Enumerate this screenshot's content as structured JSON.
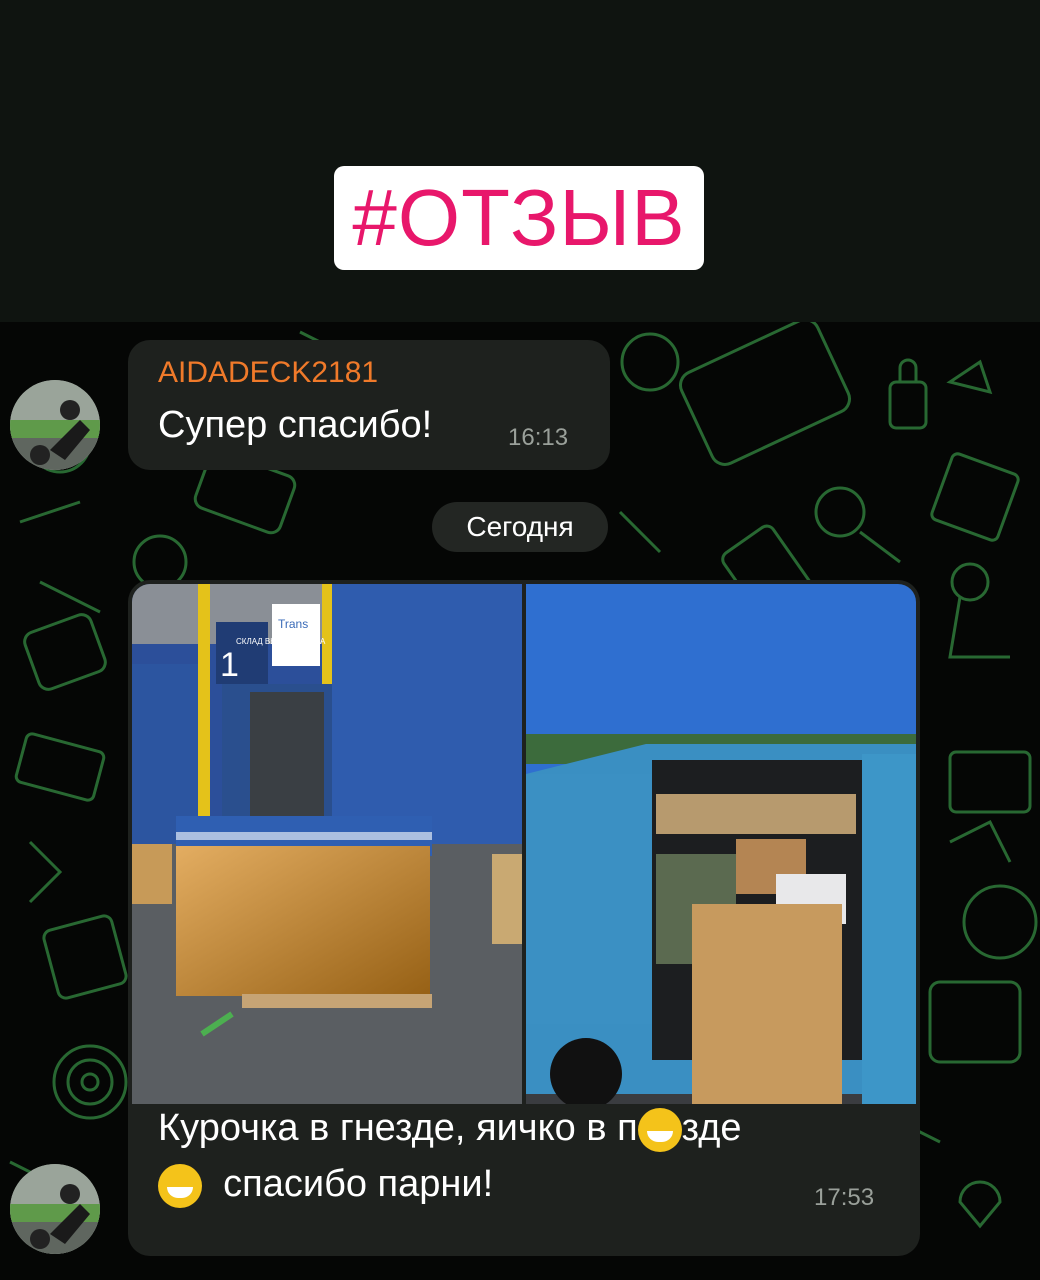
{
  "hashtag": "#ОТЗЫВ",
  "message1": {
    "sender": "AIDADECK2181",
    "text": "Супер спасибо!",
    "time": "16:13"
  },
  "date_separator": "Сегодня",
  "message2": {
    "caption_line1": "Курочка в гнезде, яичко в п",
    "caption_line1_end": "зде",
    "caption_line2": "спасибо парни!",
    "time": "17:53",
    "photo1": {
      "sign_number": "1",
      "sign_text": "СКЛАД ВЫДАЧИ ГРУЗА",
      "logo": "Trans"
    }
  },
  "colors": {
    "hashtag": "#e8176b",
    "sender": "#f07a2a",
    "bubble": "#1e211e",
    "pattern": "#2f7a3a"
  }
}
